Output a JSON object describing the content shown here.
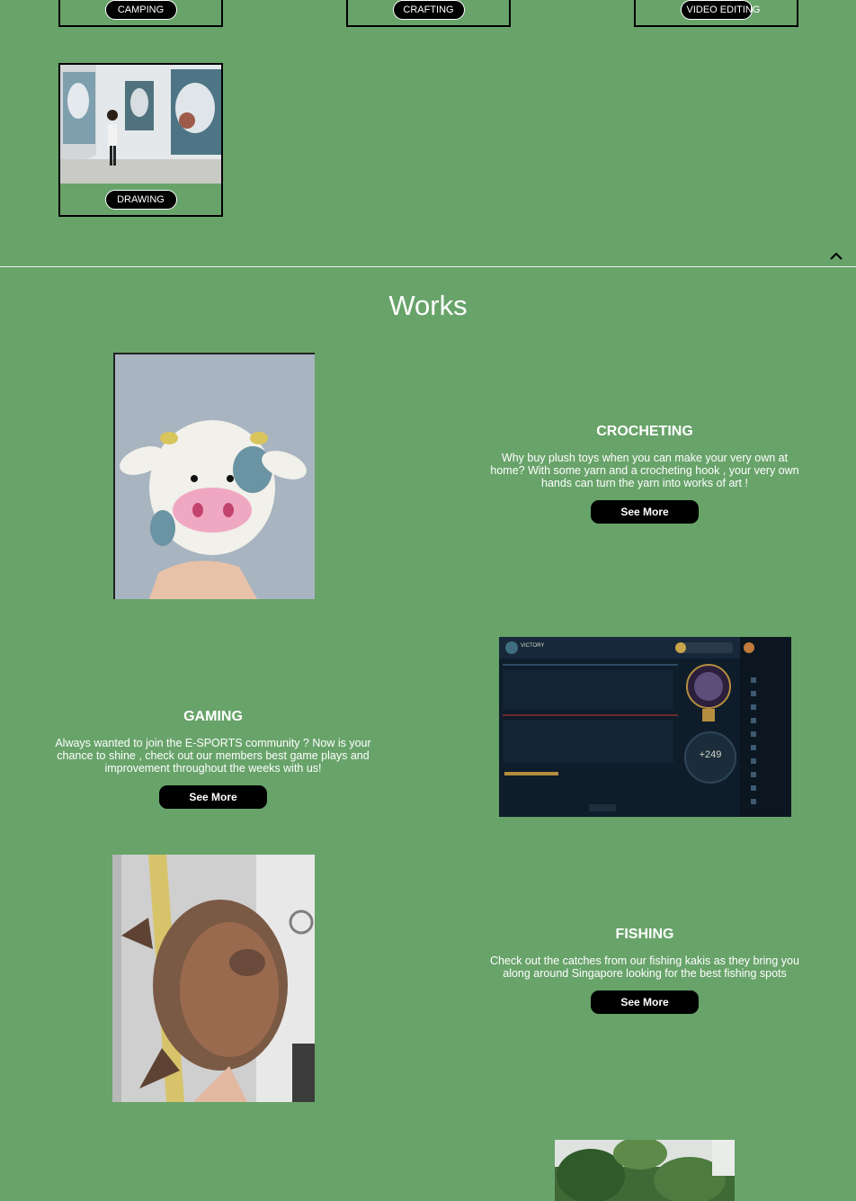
{
  "categories": [
    {
      "label": "CAMPING"
    },
    {
      "label": "CRAFTING"
    },
    {
      "label": "VIDEO EDITING"
    },
    {
      "label": "DRAWING"
    }
  ],
  "works": {
    "title": "Works",
    "items": [
      {
        "heading": "CROCHETING",
        "text": "Why buy plush toys when you can make your very own at home? With some yarn and a crocheting hook , your very own hands can turn the yarn into works of art !",
        "button": "See More"
      },
      {
        "heading": "GAMING",
        "text": "Always wanted to join the E-SPORTS community ? Now is your chance to shine , check out our members best game plays and improvement throughout the weeks with us!",
        "button": "See More"
      },
      {
        "heading": "FISHING",
        "text": "Check out the catches from our fishing kakis as they bring you along around Singapore looking for the best fishing spots",
        "button": "See More"
      }
    ]
  },
  "game": {
    "banner": "VICTORY",
    "score": "+249"
  },
  "icons": {
    "scroll_top": "chevron-up-icon"
  },
  "colors": {
    "background": "#68a36a",
    "button": "#000000",
    "text": "#ffffff"
  }
}
